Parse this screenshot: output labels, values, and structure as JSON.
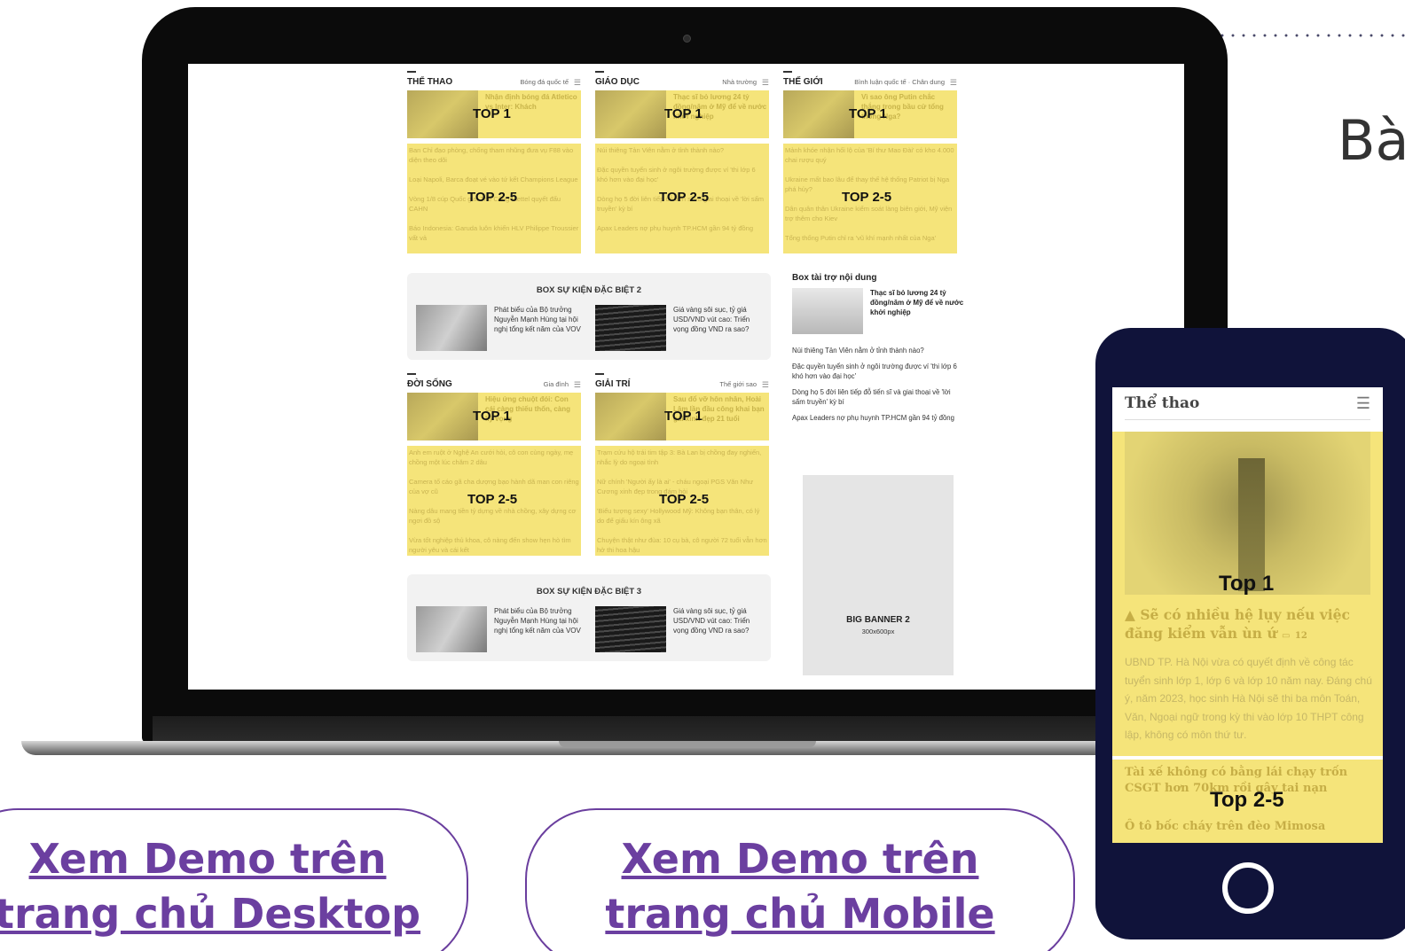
{
  "heading_partial": "Bà",
  "desktop": {
    "columns": [
      {
        "title": "THỂ THAO",
        "sub": "Bóng đá quốc tế",
        "top1_text": "Nhận định bóng đá Atletico vs Inter: Khách",
        "top1_label": "TOP 1",
        "items": [
          "Ban Chỉ đạo phòng, chống tham nhũng đưa vụ F88 vào diện theo dõi",
          "Loại Napoli, Barca đoạt vé vào tứ kết Champions League",
          "Vòng 1/8 cúp Quốc gia: Thể Công Viettel quyết đấu CAHN",
          "Báo Indonesia: Garuda luôn khiến HLV Philippe Troussier vất vả"
        ],
        "top25_label": "TOP 2-5"
      },
      {
        "title": "GIÁO DỤC",
        "sub": "Nhà trường",
        "top1_text": "Thạc sĩ bỏ lương 24 tỷ đồng/năm ở Mỹ để về nước khởi nghiệp",
        "top1_label": "TOP 1",
        "items": [
          "Núi thiêng Tản Viên nằm ở tỉnh thành nào?",
          "Đặc quyền tuyển sinh ở ngôi trường được ví 'thi lớp 6 khó hơn vào đại học'",
          "Dòng họ 5 đời liên tiếp đỗ tiến sĩ và giai thoại về 'lời sấm truyền' kỳ bí",
          "Apax Leaders nợ phụ huynh TP.HCM gần 94 tỷ đồng"
        ],
        "top25_label": "TOP 2-5"
      },
      {
        "title": "THẾ GIỚI",
        "sub": "Bình luận quốc tế · Chân dung",
        "top1_text": "Vì sao ông Putin chắc thắng trong bầu cử tổng thống Nga?",
        "top1_label": "TOP 1",
        "items": [
          "Mảnh khóe nhận hối lộ của 'Bí thư Mao Đài' có kho 4.000 chai rượu quý",
          "Ukraine mất bao lâu để thay thế hệ thống Patriot bị Nga phá hủy?",
          "Dân quân thân Ukraine kiểm soát làng biên giới, Mỹ viện trợ thêm cho Kiev",
          "Tổng thống Putin chỉ ra 'vũ khí mạnh nhất của Nga'"
        ],
        "top25_label": "TOP 2-5"
      },
      {
        "title": "ĐỜI SỐNG",
        "sub": "Gia đình",
        "top1_text": "Hiệu ứng chuột đói: Con cái càng thiếu thốn, càng kỳ vọng",
        "top1_label": "TOP 1",
        "items": [
          "Anh em ruột ở Nghệ An cưới hỏi, cô con cùng ngày, mẹ chồng một lúc chăm 2 dâu",
          "Camera tố cáo gã cha dượng bạo hành dã man con riêng của vợ cũ",
          "Nàng dâu mang tiền tỷ dựng về nhà chồng, xây dựng cơ ngơi đồ sộ",
          "Vừa tốt nghiệp thủ khoa, cô nàng đến show hẹn hò tìm người yêu và cái kết"
        ],
        "top25_label": "TOP 2-5"
      },
      {
        "title": "GIẢI TRÍ",
        "sub": "Thế giới sao",
        "top1_text": "Sau đổ vỡ hôn nhân, Hoài Lâm lần đầu công khai bạn gái xinh đẹp 21 tuổi",
        "top1_label": "TOP 1",
        "items": [
          "Trạm cứu hộ trái tim tập 3: Bà Lan bị chồng đay nghiến, nhắc lỳ do ngoại tình",
          "Nữ chính 'Người ấy là ai' - cháu ngoại PGS Văn Như Cương xinh đẹp trong đám hỏi",
          "'Biểu tượng sexy' Hollywood Mỹ: Không bạn thân, có lý do để giấu kín ông xã",
          "Chuyện thật như đùa: 10 cụ bà, cô người 72 tuổi vẫn hơn hở thi hoa hậu"
        ],
        "top25_label": "TOP 2-5"
      }
    ],
    "events": [
      {
        "title": "BOX SỰ KIỆN ĐẶC BIỆT 2",
        "items": [
          "Phát biểu của Bộ trưởng Nguyễn Mạnh Hùng tại hội nghị tổng kết năm của VOV",
          "Giá vàng sôi sục, tỷ giá USD/VND vút cao: Triển vọng đồng VND ra sao?"
        ]
      },
      {
        "title": "BOX SỰ KIỆN ĐẶC BIỆT 3",
        "items": [
          "Phát biểu của Bộ trưởng Nguyễn Mạnh Hùng tại hội nghị tổng kết năm của VOV",
          "Giá vàng sôi sục, tỷ giá USD/VND vút cao: Triển vọng đồng VND ra sao?"
        ]
      }
    ],
    "sponsor": {
      "title": "Box tài trợ nội dung",
      "featured": "Thạc sĩ bỏ lương 24 tỷ đồng/năm ở Mỹ để về nước khởi nghiệp",
      "items": [
        "Núi thiêng Tản Viên nằm ở tỉnh thành nào?",
        "Đặc quyền tuyển sinh ở ngôi trường được ví 'thi lớp 6 khó hơn vào đại học'",
        "Dòng họ 5 đời liên tiếp đỗ tiến sĩ và giai thoại về 'lời sấm truyền' kỳ bí",
        "Apax Leaders nợ phụ huynh TP.HCM gần 94 tỷ đồng"
      ]
    },
    "banner": {
      "title": "BIG BANNER 2",
      "size": "300x600px"
    }
  },
  "mobile": {
    "header": "Thể thao",
    "top1_label": "Top 1",
    "top1_title": "Sẽ có nhiều hệ lụy nếu việc đăng kiểm vẫn ùn ứ",
    "comment_count": "12",
    "top1_desc": "UBND TP. Hà Nội vừa có quyết định về công tác tuyển sinh lớp 1, lớp 6 và lớp 10 năm nay. Đáng chú ý, năm 2023, học sinh Hà Nội sẽ thi ba môn Toán, Văn, Ngoại ngữ trong kỳ thi vào lớp 10 THPT công lập, không có môn thứ tư.",
    "top25_label": "Top 2-5",
    "top25_items": [
      "Tài xế không có bằng lái chạy trốn CSGT hơn 70km rồi gây tai nạn",
      "Ô tô bốc cháy trên đèo Mimosa"
    ]
  },
  "buttons": {
    "desktop": {
      "line1": "Xem Demo trên",
      "line2": "trang chủ Desktop"
    },
    "mobile": {
      "line1": "Xem Demo trên",
      "line2": "trang chủ Mobile"
    }
  }
}
